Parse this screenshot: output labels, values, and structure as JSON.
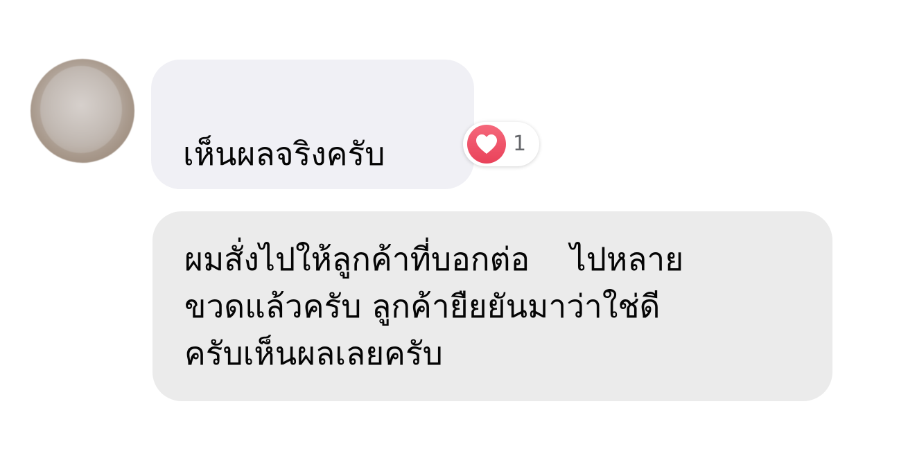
{
  "avatar": {
    "icon": "blurred-profile-avatar"
  },
  "messages": [
    {
      "text": "เห็นผลจริงครับ",
      "reaction": {
        "icon": "heart-icon",
        "count": "1",
        "color": "#f0506e"
      }
    },
    {
      "text": "ผมสั่งไปให้ลูกค้าที่บอกต่อ    ไปหลาย\nขวดแล้วครับ ลูกค้ายืยยันมาว่าใช่ดี\nครับเห็นผลเลยครับ"
    }
  ],
  "colors": {
    "bubble_primary": "#f0f0f5",
    "bubble_secondary": "#ebebeb",
    "text": "#050505",
    "reaction_count": "#65676b"
  }
}
